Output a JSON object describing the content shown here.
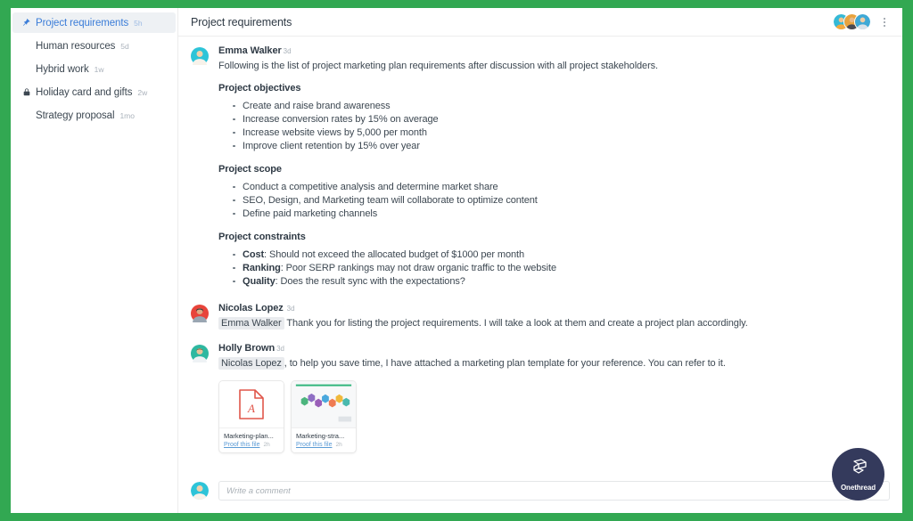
{
  "theme": {
    "frame_green": "#32a852",
    "accent_blue": "#3b7dd8",
    "link_blue": "#5b9bd5",
    "badge_navy": "#343a5c",
    "mention_bg": "#e9ebee"
  },
  "sidebar": {
    "items": [
      {
        "label": "Project requirements",
        "time": "5h",
        "icon": "pin-icon",
        "active": true
      },
      {
        "label": "Human resources",
        "time": "5d",
        "icon": "",
        "active": false
      },
      {
        "label": "Hybrid work",
        "time": "1w",
        "icon": "",
        "active": false
      },
      {
        "label": "Holiday card and gifts",
        "time": "2w",
        "icon": "lock-icon",
        "active": false
      },
      {
        "label": "Strategy proposal",
        "time": "1mo",
        "icon": "",
        "active": false
      }
    ]
  },
  "topbar": {
    "title": "Project requirements",
    "members_icon": "avatar-group-icon",
    "menu_icon": "more-vertical-icon"
  },
  "thread": {
    "messages": [
      {
        "author": "Emma Walker",
        "time": "3d",
        "intro": "Following is the list of project marketing plan requirements after discussion with all project stakeholders.",
        "sections": [
          {
            "title": "Project objectives",
            "bullets": [
              {
                "lead": "",
                "text": "Create and raise brand awareness"
              },
              {
                "lead": "",
                "text": "Increase conversion rates by 15% on average"
              },
              {
                "lead": "",
                "text": "Increase website views by 5,000 per month"
              },
              {
                "lead": "",
                "text": "Improve client retention by 15% over year"
              }
            ]
          },
          {
            "title": "Project scope",
            "bullets": [
              {
                "lead": "",
                "text": "Conduct a competitive analysis and determine market share"
              },
              {
                "lead": "",
                "text": "SEO, Design, and Marketing team will collaborate to optimize content"
              },
              {
                "lead": "",
                "text": "Define paid marketing channels"
              }
            ]
          },
          {
            "title": "Project constraints",
            "bullets": [
              {
                "lead": "Cost",
                "text": ": Should not exceed the allocated budget of $1000 per month"
              },
              {
                "lead": "Ranking",
                "text": ": Poor SERP rankings may not draw organic traffic to the website"
              },
              {
                "lead": "Quality",
                "text": ": Does the result sync with the expectations?"
              }
            ]
          }
        ]
      },
      {
        "author": "Nicolas Lopez",
        "time": "3d",
        "mention": "Emma Walker",
        "text": " Thank you for listing the project requirements. I will take a look at them and create a project plan accordingly."
      },
      {
        "author": "Holly Brown",
        "time": "3d",
        "mention": "Nicolas Lopez",
        "text": ", to help you save time, I have attached a marketing plan template for your reference. You can refer to it."
      }
    ],
    "attachments": [
      {
        "name": "Marketing-plan...",
        "link": "Proof this file",
        "time": "2h",
        "kind": "pdf"
      },
      {
        "name": "Marketing-stra...",
        "link": "Proof this file",
        "time": "2h",
        "kind": "image"
      }
    ]
  },
  "composer": {
    "placeholder": "Write a comment",
    "value": ""
  },
  "badge": {
    "label": "Onethread",
    "icon": "onethread-logo-icon"
  }
}
